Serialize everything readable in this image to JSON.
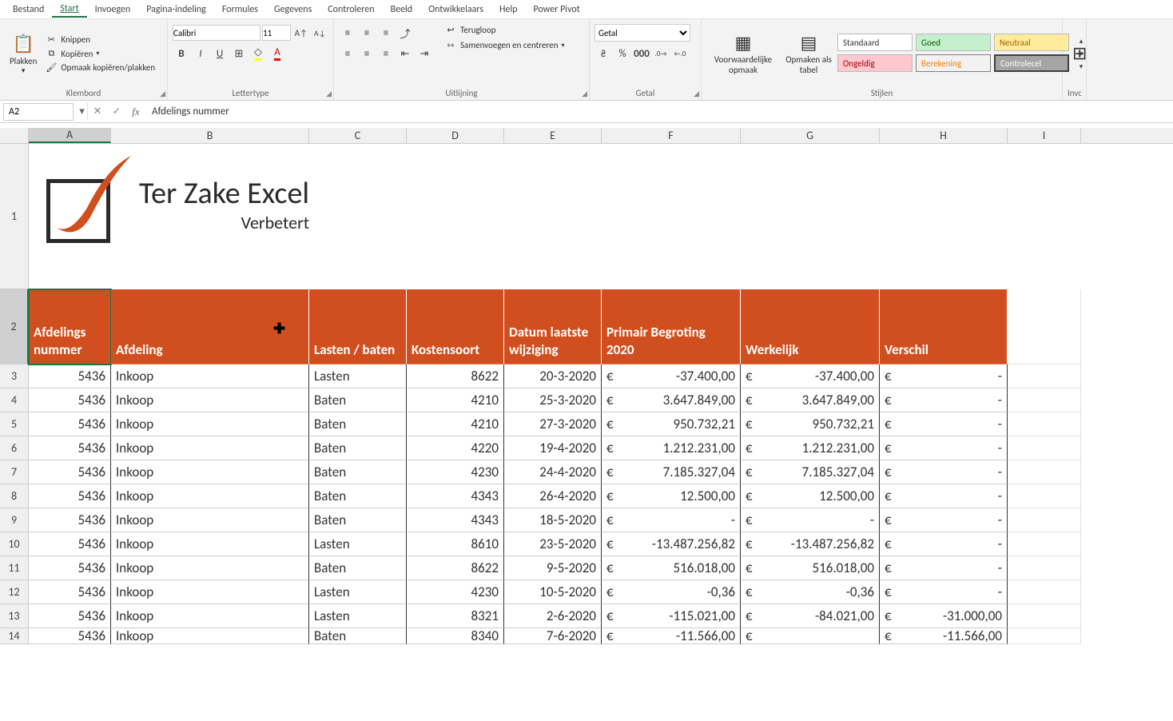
{
  "menu": [
    "Bestand",
    "Start",
    "Invoegen",
    "Pagina-indeling",
    "Formules",
    "Gegevens",
    "Controleren",
    "Beeld",
    "Ontwikkelaars",
    "Help",
    "Power Pivot"
  ],
  "active_menu": "Start",
  "ribbon": {
    "clipboard": {
      "paste": "Plakken",
      "cut": "Knippen",
      "copy": "Kopiëren",
      "format": "Opmaak kopiëren/plakken",
      "label": "Klembord"
    },
    "font": {
      "name": "Calibri",
      "size": "11",
      "label": "Lettertype"
    },
    "align": {
      "wrap": "Terugloop",
      "merge": "Samenvoegen en centreren",
      "label": "Uitlijning"
    },
    "number": {
      "format": "Getal",
      "label": "Getal"
    },
    "styles": {
      "cond": "Voorwaardelijke opmaak",
      "table": "Opmaken als tabel",
      "cells": [
        "Standaard",
        "Goed",
        "Neutraal",
        "Ongeldig",
        "Berekening",
        "Controlecel"
      ],
      "label": "Stijlen"
    },
    "insert_label": "Invc"
  },
  "namebox": "A2",
  "formula": "Afdelings nummer",
  "columns": [
    "A",
    "B",
    "C",
    "D",
    "E",
    "F",
    "G",
    "H",
    "I"
  ],
  "logo": {
    "title": "Ter Zake Excel",
    "sub": "Verbetert"
  },
  "headers": [
    "Afdelings nummer",
    "Afdeling",
    "Lasten / baten",
    "Kostensoort",
    "Datum laatste wijziging",
    "Primair Begroting 2020",
    "Werkelijk",
    "Verschil"
  ],
  "rows": [
    {
      "r": 3,
      "a": "5436",
      "b": "Inkoop",
      "c": "Lasten",
      "d": "8622",
      "e": "20-3-2020",
      "f": "-37.400,00",
      "g": "-37.400,00",
      "h": "-"
    },
    {
      "r": 4,
      "a": "5436",
      "b": "Inkoop",
      "c": "Baten",
      "d": "4210",
      "e": "25-3-2020",
      "f": "3.647.849,00",
      "g": "3.647.849,00",
      "h": "-"
    },
    {
      "r": 5,
      "a": "5436",
      "b": "Inkoop",
      "c": "Baten",
      "d": "4210",
      "e": "27-3-2020",
      "f": "950.732,21",
      "g": "950.732,21",
      "h": "-"
    },
    {
      "r": 6,
      "a": "5436",
      "b": "Inkoop",
      "c": "Baten",
      "d": "4220",
      "e": "19-4-2020",
      "f": "1.212.231,00",
      "g": "1.212.231,00",
      "h": "-"
    },
    {
      "r": 7,
      "a": "5436",
      "b": "Inkoop",
      "c": "Baten",
      "d": "4230",
      "e": "24-4-2020",
      "f": "7.185.327,04",
      "g": "7.185.327,04",
      "h": "-"
    },
    {
      "r": 8,
      "a": "5436",
      "b": "Inkoop",
      "c": "Baten",
      "d": "4343",
      "e": "26-4-2020",
      "f": "12.500,00",
      "g": "12.500,00",
      "h": "-"
    },
    {
      "r": 9,
      "a": "5436",
      "b": "Inkoop",
      "c": "Baten",
      "d": "4343",
      "e": "18-5-2020",
      "f": "-",
      "g": "-",
      "h": "-"
    },
    {
      "r": 10,
      "a": "5436",
      "b": "Inkoop",
      "c": "Lasten",
      "d": "8610",
      "e": "23-5-2020",
      "f": "-13.487.256,82",
      "g": "-13.487.256,82",
      "h": "-"
    },
    {
      "r": 11,
      "a": "5436",
      "b": "Inkoop",
      "c": "Baten",
      "d": "8622",
      "e": "9-5-2020",
      "f": "516.018,00",
      "g": "516.018,00",
      "h": "-"
    },
    {
      "r": 12,
      "a": "5436",
      "b": "Inkoop",
      "c": "Lasten",
      "d": "4230",
      "e": "10-5-2020",
      "f": "-0,36",
      "g": "-0,36",
      "h": "-"
    },
    {
      "r": 13,
      "a": "5436",
      "b": "Inkoop",
      "c": "Lasten",
      "d": "8321",
      "e": "2-6-2020",
      "f": "-115.021,00",
      "g": "-84.021,00",
      "h": "-31.000,00"
    },
    {
      "r": 14,
      "a": "5436",
      "b": "Inkoop",
      "c": "Baten",
      "d": "8340",
      "e": "7-6-2020",
      "f": "-11.566,00",
      "g": "",
      "h": "-11.566,00"
    }
  ]
}
